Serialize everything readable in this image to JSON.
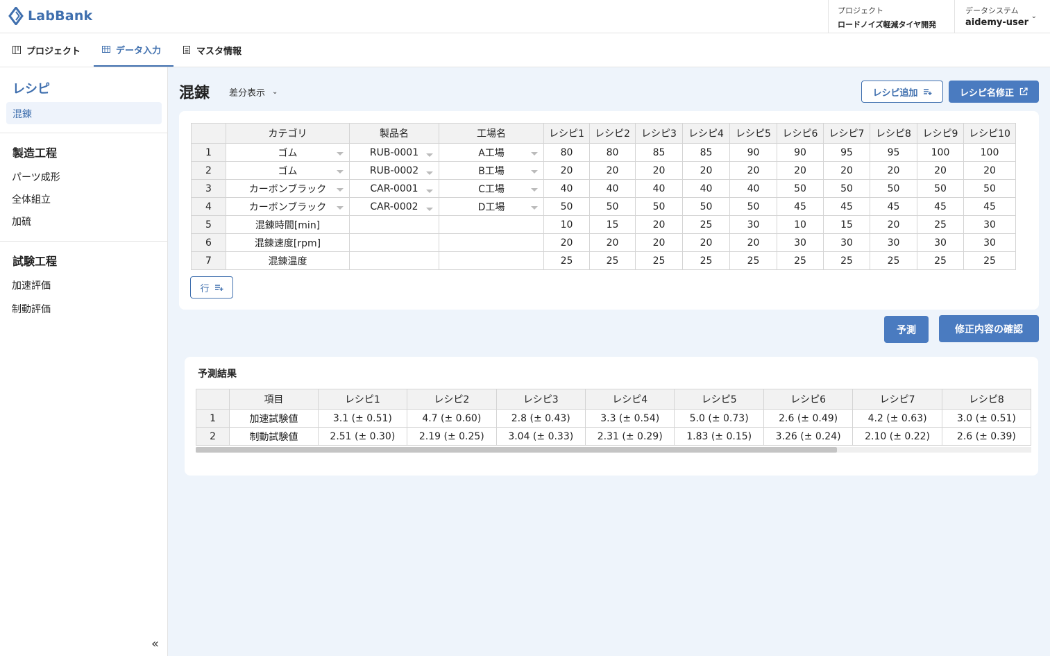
{
  "app": {
    "logo_text": "LabBank",
    "brand_color": "#3f6fae"
  },
  "header": {
    "project_label": "プロジェクト",
    "project_name": "ロードノイズ軽減タイヤ開発",
    "system_label": "データシステム",
    "user_name": "aidemy-user"
  },
  "nav": {
    "tabs": [
      {
        "label": "プロジェクト",
        "icon": "kanban-icon",
        "active": false
      },
      {
        "label": "データ入力",
        "icon": "table-icon",
        "active": true
      },
      {
        "label": "マスタ情報",
        "icon": "document-icon",
        "active": false
      }
    ]
  },
  "sidebar": {
    "section_title": "レシピ",
    "selected_item": "混錬",
    "groups": [
      {
        "heading": "製造工程",
        "items": [
          "パーツ成形",
          "全体組立",
          "加硫"
        ]
      },
      {
        "heading": "試験工程",
        "items": [
          "加速評価",
          "制動評価"
        ]
      }
    ],
    "collapse_glyph": "«"
  },
  "main": {
    "title": "混錬",
    "diff_label": "差分表示",
    "add_recipe_label": "レシピ追加",
    "rename_recipe_label": "レシピ名修正",
    "add_row_label": "行",
    "predict_label": "予測",
    "confirm_label": "修正内容の確認"
  },
  "recipe_table": {
    "headers": [
      "",
      "カテゴリ",
      "製品名",
      "工場名",
      "レシピ1",
      "レシピ2",
      "レシピ3",
      "レシピ4",
      "レシピ5",
      "レシピ6",
      "レシピ7",
      "レシピ8",
      "レシピ9",
      "レシピ10"
    ],
    "rows": [
      {
        "idx": "1",
        "category": "ゴム",
        "product": "RUB-0001",
        "factory": "A工場",
        "values": [
          "80",
          "80",
          "85",
          "85",
          "90",
          "90",
          "95",
          "95",
          "100",
          "100"
        ]
      },
      {
        "idx": "2",
        "category": "ゴム",
        "product": "RUB-0002",
        "factory": "B工場",
        "values": [
          "20",
          "20",
          "20",
          "20",
          "20",
          "20",
          "20",
          "20",
          "20",
          "20"
        ]
      },
      {
        "idx": "3",
        "category": "カーボンブラック",
        "product": "CAR-0001",
        "factory": "C工場",
        "values": [
          "40",
          "40",
          "40",
          "40",
          "40",
          "50",
          "50",
          "50",
          "50",
          "50"
        ]
      },
      {
        "idx": "4",
        "category": "カーボンブラック",
        "product": "CAR-0002",
        "factory": "D工場",
        "values": [
          "50",
          "50",
          "50",
          "50",
          "50",
          "45",
          "45",
          "45",
          "45",
          "45"
        ]
      },
      {
        "idx": "5",
        "category": "混錬時間[min]",
        "product": "",
        "factory": "",
        "values": [
          "10",
          "15",
          "20",
          "25",
          "30",
          "10",
          "15",
          "20",
          "25",
          "30"
        ]
      },
      {
        "idx": "6",
        "category": "混錬速度[rpm]",
        "product": "",
        "factory": "",
        "values": [
          "20",
          "20",
          "20",
          "20",
          "20",
          "30",
          "30",
          "30",
          "30",
          "30"
        ]
      },
      {
        "idx": "7",
        "category": "混錬温度",
        "product": "",
        "factory": "",
        "values": [
          "25",
          "25",
          "25",
          "25",
          "25",
          "25",
          "25",
          "25",
          "25",
          "25"
        ]
      }
    ]
  },
  "results": {
    "title": "予測結果",
    "headers": [
      "",
      "項目",
      "レシピ1",
      "レシピ2",
      "レシピ3",
      "レシピ4",
      "レシピ5",
      "レシピ6",
      "レシピ7",
      "レシピ8"
    ],
    "rows": [
      {
        "idx": "1",
        "item": "加速試験値",
        "values": [
          "3.1 (± 0.51)",
          "4.7 (± 0.60)",
          "2.8 (± 0.43)",
          "3.3 (± 0.54)",
          "5.0 (± 0.73)",
          "2.6 (± 0.49)",
          "4.2 (± 0.63)",
          "3.0 (± 0.51)"
        ]
      },
      {
        "idx": "2",
        "item": "制動試験値",
        "values": [
          "2.51 (± 0.30)",
          "2.19 (± 0.25)",
          "3.04 (± 0.33)",
          "2.31 (± 0.29)",
          "1.83 (± 0.15)",
          "3.26 (± 0.24)",
          "2.10 (± 0.22)",
          "2.6 (± 0.39)"
        ]
      }
    ]
  }
}
